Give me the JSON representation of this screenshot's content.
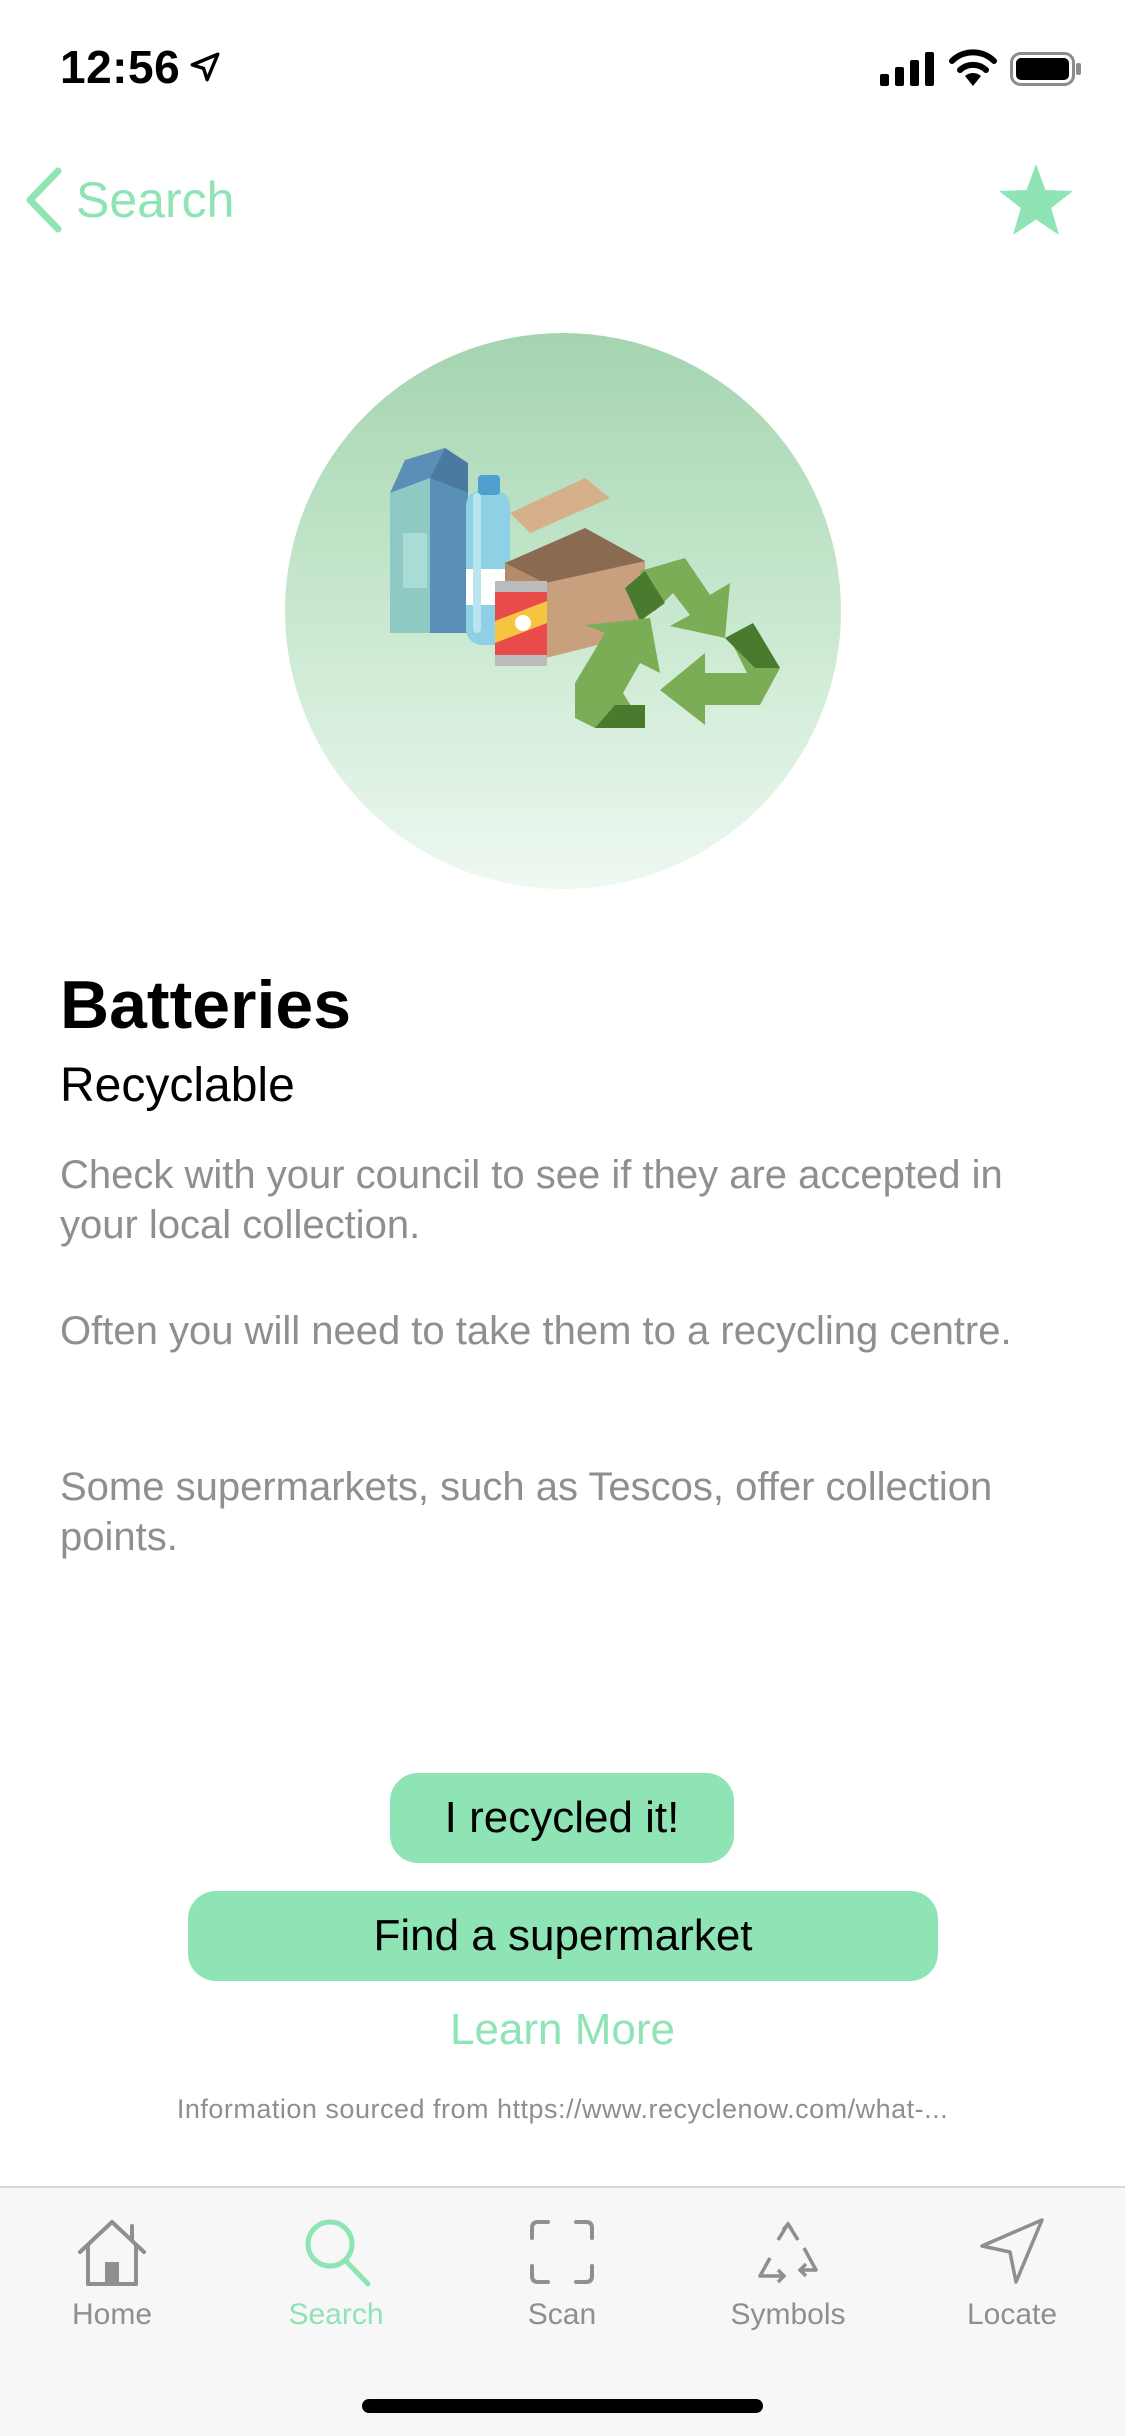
{
  "status_bar": {
    "time": "12:56"
  },
  "nav": {
    "back_label": "Search",
    "favorite_icon": "star-icon"
  },
  "item": {
    "title": "Batteries",
    "status": "Recyclable",
    "paragraphs": [
      "Check with your council to see if they are accepted in your local collection.",
      "Often you will need to take them to a recycling centre.",
      "Some supermarkets, such as Tescos, offer collection points."
    ]
  },
  "actions": {
    "recycled_label": "I recycled it!",
    "supermarket_label": "Find a supermarket",
    "learn_more_label": "Learn More",
    "source_text": "Information sourced from https://www.recyclenow.com/what-..."
  },
  "tab_bar": {
    "tabs": [
      {
        "label": "Home",
        "icon": "home-icon",
        "active": false
      },
      {
        "label": "Search",
        "icon": "search-icon",
        "active": true
      },
      {
        "label": "Scan",
        "icon": "scan-icon",
        "active": false
      },
      {
        "label": "Symbols",
        "icon": "recycle-symbol-icon",
        "active": false
      },
      {
        "label": "Locate",
        "icon": "location-arrow-icon",
        "active": false
      }
    ]
  },
  "colors": {
    "accent": "#8ee4b4",
    "secondary_text": "#8e8e93",
    "primary_text": "#000000"
  }
}
